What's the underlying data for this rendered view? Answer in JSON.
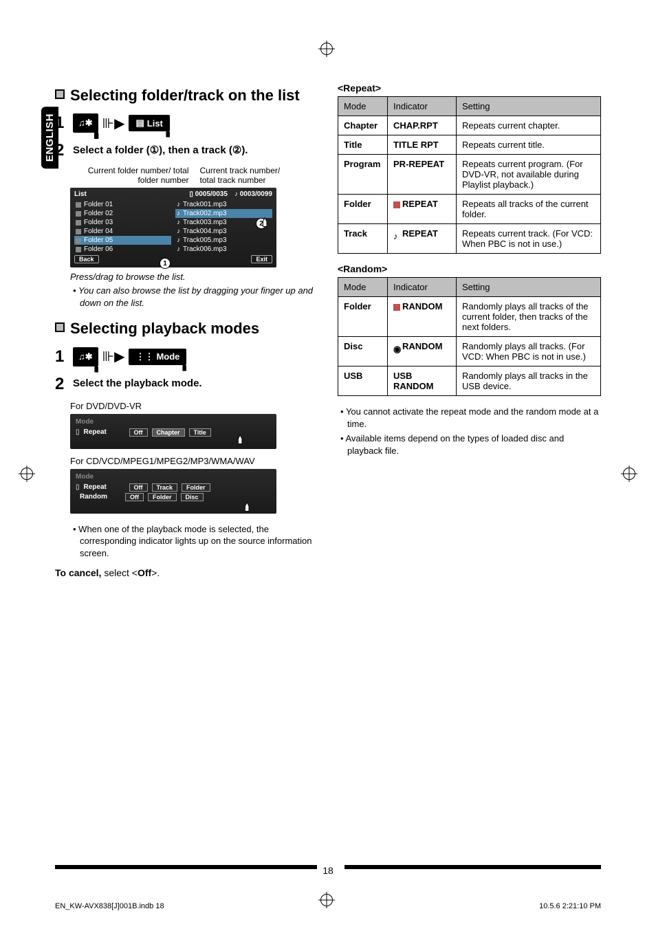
{
  "lang_tab": "ENGLISH",
  "left": {
    "h1a": "Selecting folder/track on the list",
    "step1": "1",
    "listbtn": "List",
    "step2": "2",
    "step2text_a": "Select a folder (",
    "step2text_b": "), then a track (",
    "step2text_c": ").",
    "cap_left_1": "Current folder number/ total",
    "cap_left_2": "folder number",
    "cap_right_1": "Current track number/",
    "cap_right_2": "total track number",
    "panel": {
      "title": "List",
      "counter_folder": "0005/0035",
      "counter_track": "0003/0099",
      "folders": [
        "Folder 01",
        "Folder 02",
        "Folder 03",
        "Folder 04",
        "Folder 05",
        "Folder 06"
      ],
      "tracks": [
        "Track001.mp3",
        "Track002.mp3",
        "Track003.mp3",
        "Track004.mp3",
        "Track005.mp3",
        "Track006.mp3"
      ],
      "selected_folder_index": 4,
      "selected_track_index": 1,
      "back": "Back",
      "exit": "Exit"
    },
    "note1": "Press/drag to browse the list.",
    "note2": "You can also browse the list by dragging your finger up and down on the list.",
    "h1b": "Selecting playback modes",
    "modebtn": "Mode",
    "step2b": "Select the playback mode.",
    "sub1": "For DVD/DVD-VR",
    "modepanel1": {
      "title": "Mode",
      "row1_label": "Repeat",
      "row1_opts": [
        "Off",
        "Chapter",
        "Title"
      ],
      "row1_sel": 1
    },
    "sub2": "For CD/VCD/MPEG1/MPEG2/MP3/WMA/WAV",
    "modepanel2": {
      "title": "Mode",
      "row1_label": "Repeat",
      "row1_opts": [
        "Off",
        "Track",
        "Folder"
      ],
      "row2_label": "Random",
      "row2_opts": [
        "Off",
        "Folder",
        "Disc"
      ]
    },
    "note3": "When one of the playback mode is selected, the corresponding indicator lights up on the source information screen.",
    "cancel_a": "To cancel,",
    "cancel_b": " select <",
    "cancel_c": "Off",
    "cancel_d": ">."
  },
  "right": {
    "repeat_hdr": "<Repeat>",
    "repeat": {
      "h1": "Mode",
      "h2": "Indicator",
      "h3": "Setting",
      "rows": [
        {
          "mode": "Chapter",
          "ind": "CHAP.RPT",
          "set": "Repeats current chapter."
        },
        {
          "mode": "Title",
          "ind": "TITLE RPT",
          "set": "Repeats current title."
        },
        {
          "mode": "Program",
          "ind": "PR-REPEAT",
          "set": "Repeats current program. (For DVD-VR, not available during Playlist playback.)"
        },
        {
          "mode": "Folder",
          "ind": "REPEAT",
          "icon": "folder",
          "set": "Repeats all tracks of the current folder."
        },
        {
          "mode": "Track",
          "ind": "REPEAT",
          "icon": "note",
          "set": "Repeats current track. (For VCD: When PBC is not in use.)"
        }
      ]
    },
    "random_hdr": "<Random>",
    "random": {
      "h1": "Mode",
      "h2": "Indicator",
      "h3": "Setting",
      "rows": [
        {
          "mode": "Folder",
          "ind": "RANDOM",
          "icon": "folder",
          "set": "Randomly plays all tracks of the current folder, then tracks of the next folders."
        },
        {
          "mode": "Disc",
          "ind": "RANDOM",
          "icon": "disc",
          "set": "Randomly plays all tracks. (For VCD: When PBC is not in use.)"
        },
        {
          "mode": "USB",
          "ind": "USB RANDOM",
          "set": "Randomly plays all tracks in the USB device."
        }
      ]
    },
    "notes": [
      "You cannot activate the repeat mode and the random mode at a time.",
      "Available items depend on the types of loaded disc and playback file."
    ]
  },
  "pagenum": "18",
  "print_footer_left": "EN_KW-AVX838[J]001B.indb   18",
  "print_footer_right": "10.5.6   2:21:10 PM"
}
